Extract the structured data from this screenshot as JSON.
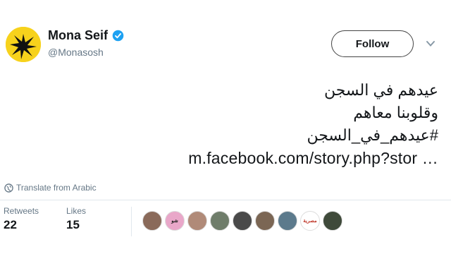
{
  "user": {
    "display_name": "Mona Seif",
    "handle": "@Monasosh",
    "verified": true
  },
  "follow_label": "Follow",
  "tweet": {
    "lines": [
      "عيدهم في السجن",
      "وقلوبنا معاهم"
    ],
    "hashtag": "#عيدهم_في_السجن",
    "link": "m.facebook.com/story.php?stor …"
  },
  "translate_label": "Translate from Arabic",
  "stats": {
    "retweets_label": "Retweets",
    "retweets_count": "22",
    "likes_label": "Likes",
    "likes_count": "15"
  },
  "likers": [
    {
      "label": "",
      "color": "#8a6a5a"
    },
    {
      "label": "شو",
      "color": "#e9a7c9"
    },
    {
      "label": "",
      "color": "#b08a78"
    },
    {
      "label": "",
      "color": "#6f7d6a"
    },
    {
      "label": "",
      "color": "#4a4a4a"
    },
    {
      "label": "",
      "color": "#7b6654"
    },
    {
      "label": "",
      "color": "#5c7a8c"
    },
    {
      "label": "مصرية",
      "color": "#ffffff"
    },
    {
      "label": "",
      "color": "#3f4a3a"
    }
  ],
  "colors": {
    "avatar_bg": "#f7d21c",
    "verified_blue": "#1da1f2",
    "secondary_text": "#657786"
  },
  "icons": {
    "verified": "verified-badge-icon",
    "caret": "chevron-down-icon",
    "translate": "globe-icon"
  }
}
